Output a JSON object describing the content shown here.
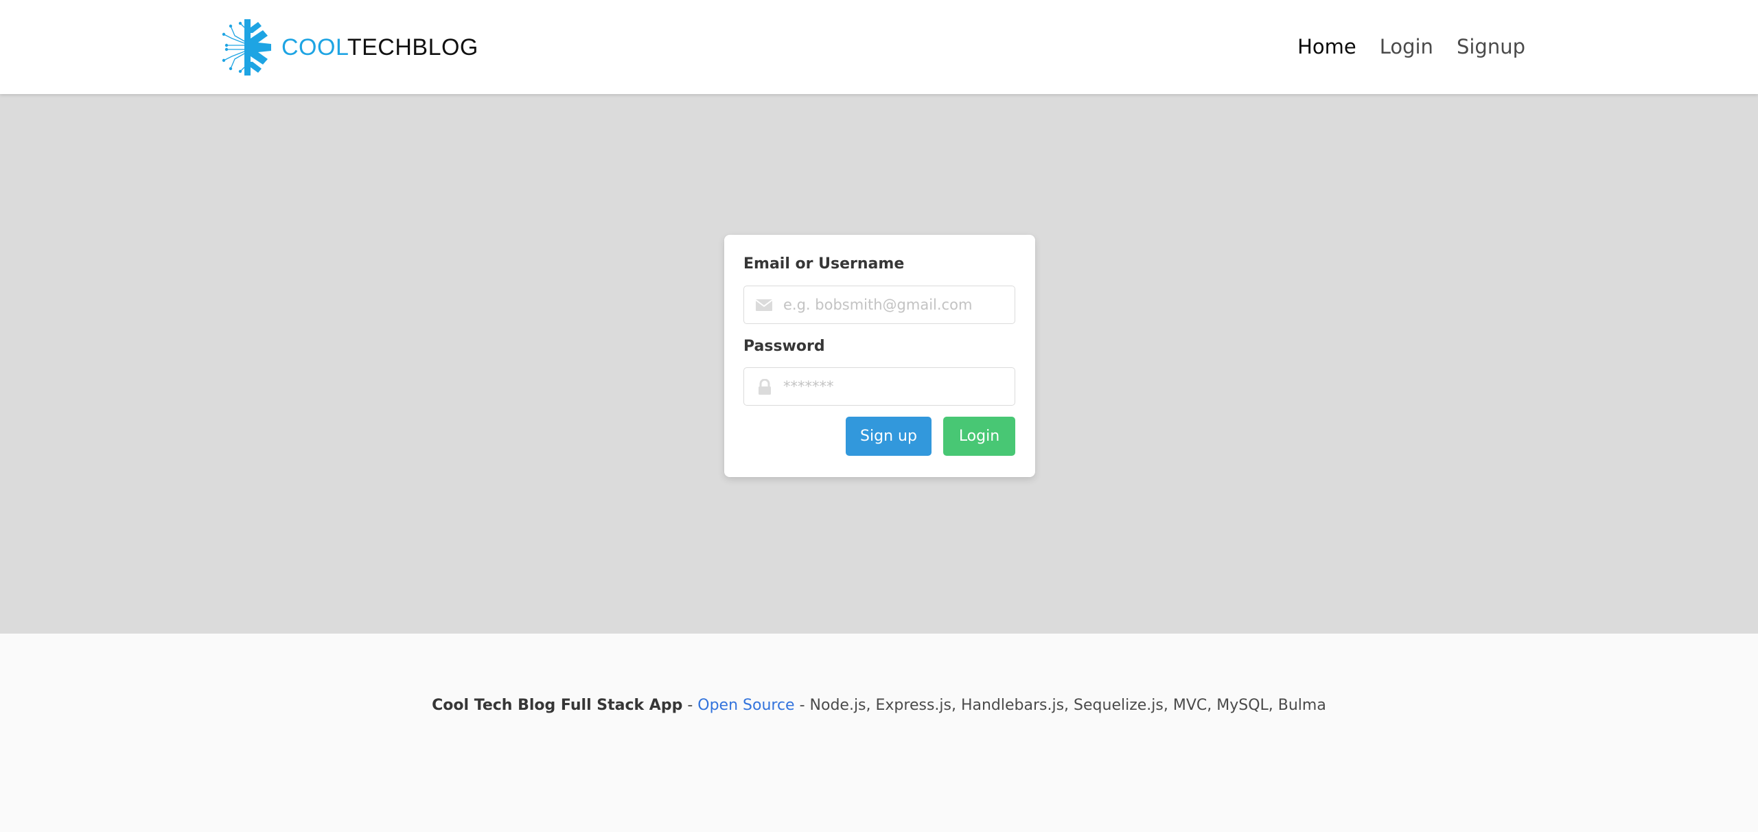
{
  "navbar": {
    "brand": {
      "part1": "COOL",
      "part2": "TECHBLOG",
      "icon": "snowflake-circuit-icon"
    },
    "links": [
      {
        "label": "Home",
        "active": true
      },
      {
        "label": "Login",
        "active": false
      },
      {
        "label": "Signup",
        "active": false
      }
    ]
  },
  "login_form": {
    "username_label": "Email or Username",
    "username_placeholder": "e.g. bobsmith@gmail.com",
    "username_value": "",
    "username_icon": "envelope-icon",
    "password_label": "Password",
    "password_placeholder": "*******",
    "password_value": "",
    "password_icon": "lock-icon",
    "signup_button": "Sign up",
    "login_button": "Login"
  },
  "footer": {
    "app_name": "Cool Tech Blog Full Stack App",
    "sep1": " - ",
    "link_label": "Open Source",
    "sep2": " - ",
    "stack": "Node.js, Express.js, Handlebars.js, Sequelize.js, MVC, MySQL, Bulma"
  },
  "colors": {
    "brand_blue": "#1ea4e3",
    "signup_blue": "#3298dc",
    "login_green": "#48c774",
    "link_blue": "#3273dc",
    "main_bg": "#dbdbdb"
  }
}
